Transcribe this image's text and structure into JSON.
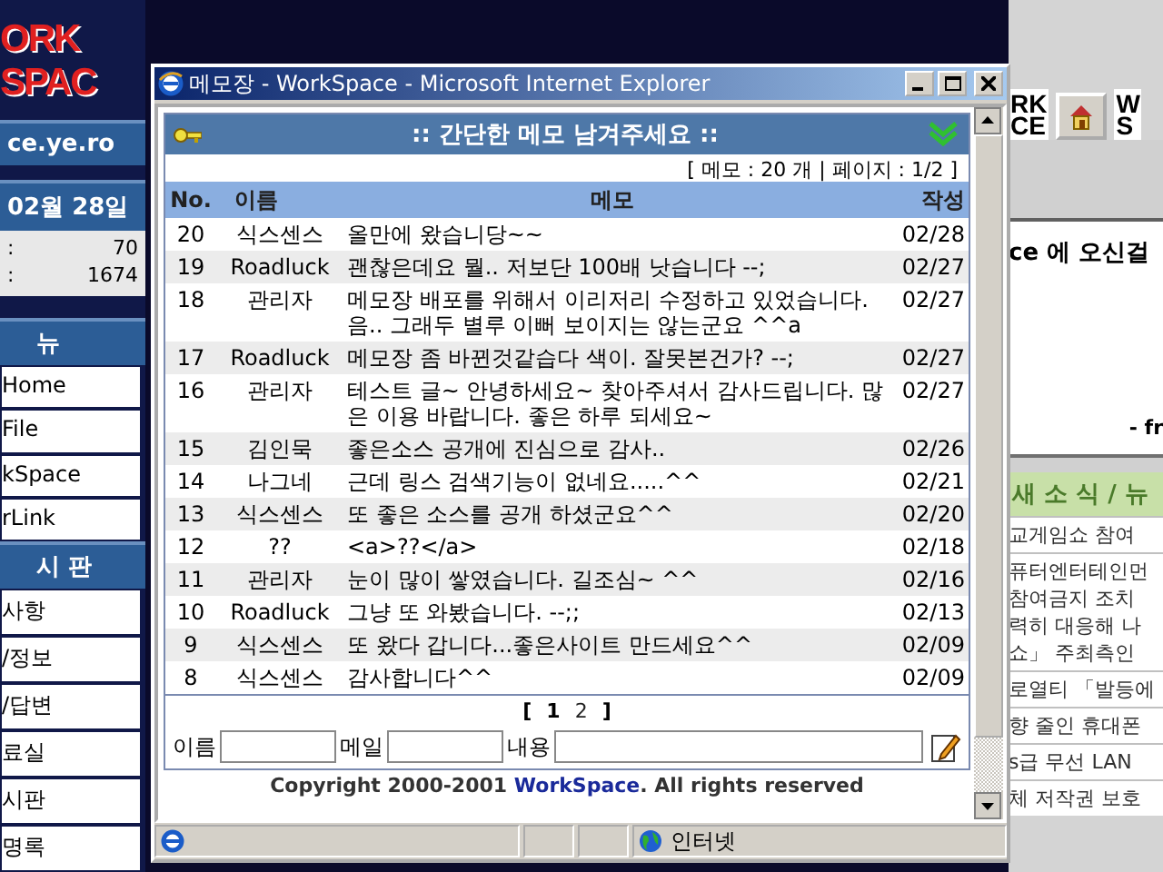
{
  "left_panel": {
    "logo": [
      "ORK",
      "SPAC"
    ],
    "site_url": "ce.ye.ro",
    "date": "02월 28일",
    "stats": [
      {
        "label": ":",
        "value": "70"
      },
      {
        "label": ":",
        "value": "1674"
      }
    ],
    "menu": {
      "title": "뉴",
      "items": [
        "Home",
        "File",
        "kSpace",
        "rLink"
      ]
    },
    "board": {
      "title": "시 판",
      "items": [
        "사항",
        "/정보",
        "/답변",
        "료실",
        "시판",
        "명록"
      ]
    }
  },
  "right_panel": {
    "logo": [
      "RK",
      "CE"
    ],
    "logo_2": [
      "W",
      "S"
    ],
    "welcome": "ce 에 오신걸",
    "signature": "- fr",
    "news": {
      "title": "새 소 식 / 뉴",
      "items": [
        {
          "lines": [
            "교게임쇼 참여"
          ]
        },
        {
          "lines": [
            "퓨터엔터테인먼",
            "참여금지 조치",
            "력히 대응해 나",
            "쇼」 주최측인"
          ]
        },
        {
          "lines": [
            "로열티 「발등에"
          ]
        },
        {
          "lines": [
            "향 줄인 휴대폰"
          ]
        },
        {
          "lines": [
            "s급 무선 LAN"
          ]
        },
        {
          "lines": [
            "체 저작권 보호"
          ]
        }
      ]
    }
  },
  "window": {
    "title": "메모장 - WorkSpace - Microsoft Internet Explorer",
    "memo": {
      "heading": ":: 간단한 메모 남겨주세요 ::",
      "summary": "[ 메모 : 20 개 | 페이지 : 1/2 ]",
      "columns": [
        "No.",
        "이름",
        "메모",
        "작성"
      ],
      "rows": [
        {
          "no": "20",
          "name": "식스센스",
          "memo": "올만에 왔습니당~~",
          "date": "02/28"
        },
        {
          "no": "19",
          "name": "Roadluck",
          "memo": "괜찮은데요 뭘.. 저보단 100배 낫습니다 --;",
          "date": "02/27"
        },
        {
          "no": "18",
          "name": "관리자",
          "memo": "메모장 배포를 위해서 이리저리 수정하고 있었습니다. 음.. 그래두 별루 이뻐 보이지는 않는군요 ^^a",
          "date": "02/27"
        },
        {
          "no": "17",
          "name": "Roadluck",
          "memo": "메모장 좀 바뀐것같습다 색이. 잘못본건가? --;",
          "date": "02/27"
        },
        {
          "no": "16",
          "name": "관리자",
          "memo": "테스트 글~ 안녕하세요~ 찾아주셔서 감사드립니다. 많은 이용 바랍니다. 좋은 하루 되세요~",
          "date": "02/27"
        },
        {
          "no": "15",
          "name": "김인묵",
          "memo": "좋은소스 공개에 진심으로 감사..",
          "date": "02/26"
        },
        {
          "no": "14",
          "name": "나그네",
          "memo": "근데 링스 검색기능이 없네요.....^^",
          "date": "02/21"
        },
        {
          "no": "13",
          "name": "식스센스",
          "memo": "또 좋은 소스를 공개 하셨군요^^",
          "date": "02/20"
        },
        {
          "no": "12",
          "name": "??",
          "memo": "<a>??</a>",
          "date": "02/18"
        },
        {
          "no": "11",
          "name": "관리자",
          "memo": "눈이 많이 쌓였습니다. 길조심~ ^^",
          "date": "02/16"
        },
        {
          "no": "10",
          "name": "Roadluck",
          "memo": "그냥 또 와봤습니다. --;;",
          "date": "02/13"
        },
        {
          "no": "9",
          "name": "식스센스",
          "memo": "또 왔다 갑니다...좋은사이트 만드세요^^",
          "date": "02/09"
        },
        {
          "no": "8",
          "name": "식스센스",
          "memo": "감사합니다^^",
          "date": "02/09"
        }
      ],
      "pager": {
        "open": "[",
        "pages": [
          {
            "label": "1",
            "selected": true
          },
          {
            "label": "2",
            "selected": false
          }
        ],
        "close": "]"
      },
      "form": {
        "fields": [
          {
            "label": "이름"
          },
          {
            "label": "메일"
          },
          {
            "label": "내용"
          }
        ]
      },
      "footer": "Copyright 2000-2001 **WorkSpace**. All rights reserved"
    },
    "status_bar": {
      "zone": "인터넷"
    }
  }
}
